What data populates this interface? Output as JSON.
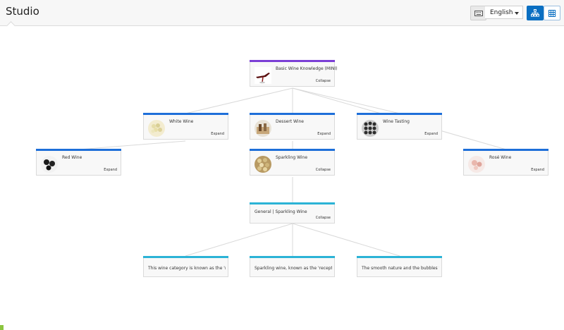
{
  "app": {
    "title": "Studio"
  },
  "toolbar": {
    "keyboard_icon": "keyboard-icon",
    "language": "English",
    "tree_view_icon": "hierarchy-icon",
    "grid_view_icon": "grid-icon",
    "accent": "#0a6fc2"
  },
  "tree": {
    "root": {
      "label": "Basic Wine Knowledge (MINI)",
      "action": "Collapse",
      "accent": "#7b3fd6"
    },
    "level1": [
      {
        "label": "White Wine",
        "action": "Expand",
        "accent": "#1e6fd9"
      },
      {
        "label": "Dessert Wine",
        "action": "Expand",
        "accent": "#1e6fd9"
      },
      {
        "label": "Wine Tasting",
        "action": "Expand",
        "accent": "#1e6fd9"
      }
    ],
    "level2": [
      {
        "label": "Red Wine",
        "action": "Expand",
        "accent": "#1e6fd9"
      },
      {
        "label": "Sparkling Wine",
        "action": "Collapse",
        "accent": "#1e6fd9"
      },
      {
        "label": "Rosé Wine",
        "action": "Expand",
        "accent": "#1e6fd9"
      }
    ],
    "level3": {
      "label": "General | Sparkling Wine",
      "action": "Collapse",
      "accent": "#2bb3d6"
    },
    "level4": [
      {
        "label": "This wine category is known as the 'reception d",
        "accent": "#2bb3d6"
      },
      {
        "label": "Sparkling wine,  known as the 'reception drink'",
        "accent": "#2bb3d6"
      },
      {
        "label": "The smooth nature and the bubbles that Spark",
        "accent": "#2bb3d6"
      }
    ]
  }
}
